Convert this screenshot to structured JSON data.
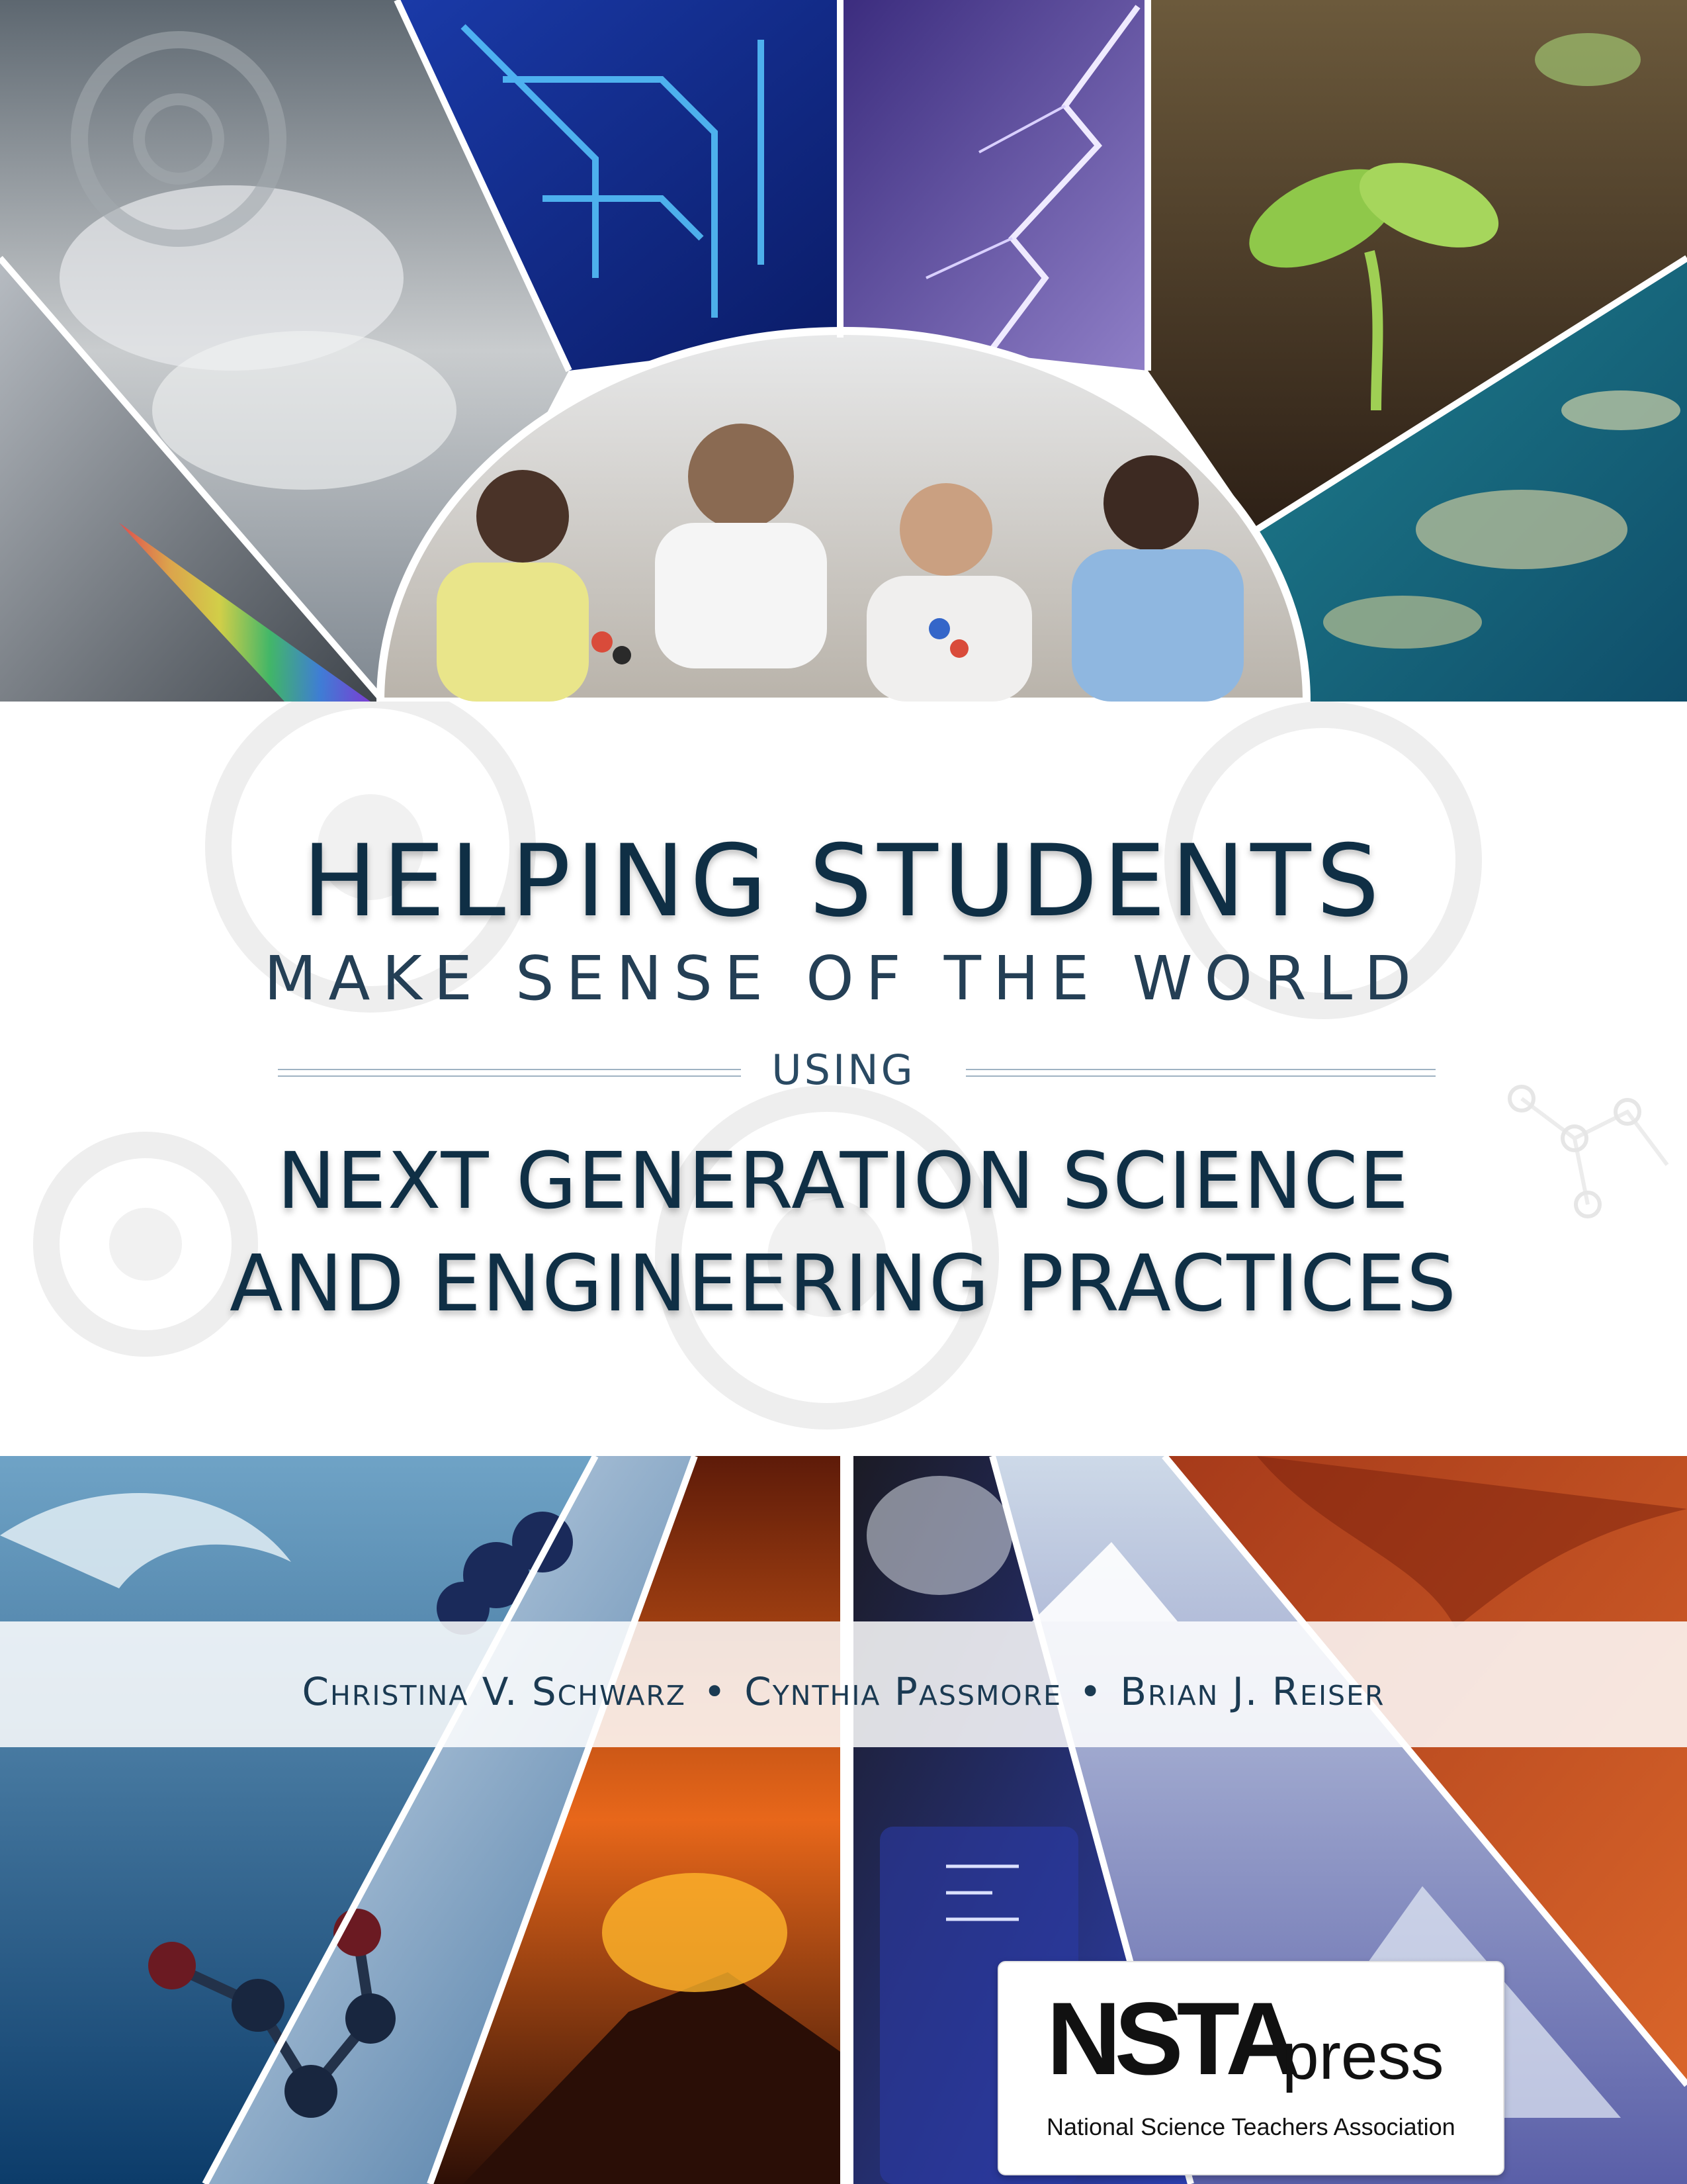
{
  "cover": {
    "title_line1": "HELPING STUDENTS",
    "title_line2": "MAKE SENSE OF THE WORLD",
    "title_connector": "USING",
    "title_line3": "NEXT GENERATION SCIENCE",
    "title_line4": "AND ENGINEERING PRACTICES"
  },
  "authors": {
    "author1": "Christina V. Schwarz",
    "author2": "Cynthia Passmore",
    "author3": "Brian J. Reiser",
    "separator": "•"
  },
  "publisher": {
    "logo_text": "NSTA",
    "logo_suffix": "press",
    "full_name": "National Science Teachers Association"
  },
  "colors": {
    "title": "#0f2f45",
    "accent_rule": "#9fb3c3"
  },
  "images": {
    "top_row": [
      "prism-rainbow-image",
      "storm-clouds-image",
      "circuit-board-image",
      "lightning-image",
      "seedling-image",
      "coral-reef-image"
    ],
    "center": "students-with-molecule-models-image",
    "bottom_row": [
      "ocean-wave-image",
      "molecule-model-image",
      "volcano-image",
      "beaker-image",
      "mountain-peak-image",
      "canyon-image"
    ]
  }
}
